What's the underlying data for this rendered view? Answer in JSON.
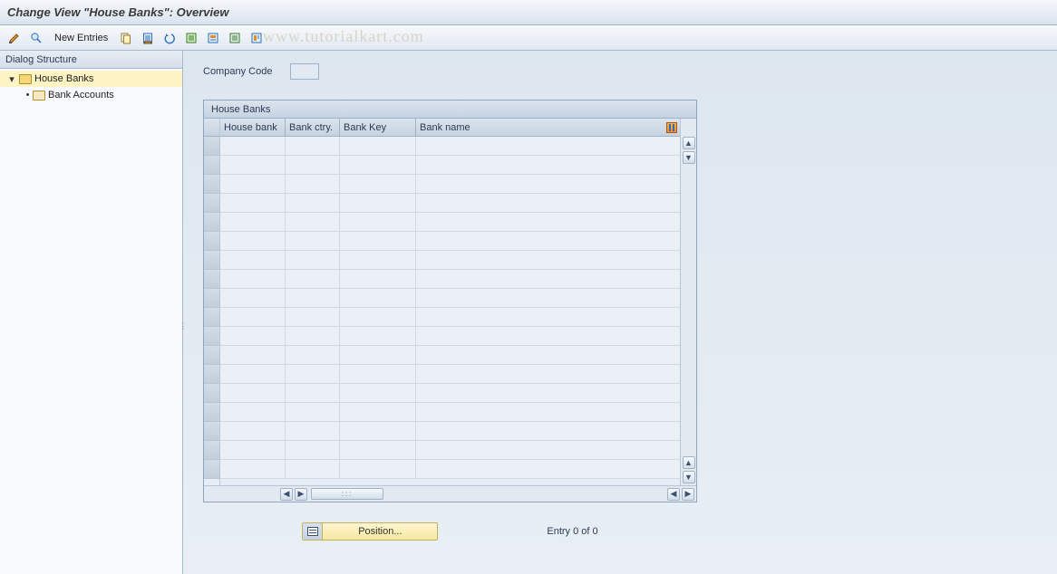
{
  "title": "Change View \"House Banks\": Overview",
  "watermark": "www.tutorialkart.com",
  "toolbar": {
    "new_entries_label": "New Entries"
  },
  "sidebar": {
    "header": "Dialog Structure",
    "items": [
      {
        "label": "House Banks",
        "selected": true,
        "expanded": true,
        "level": 1
      },
      {
        "label": "Bank Accounts",
        "selected": false,
        "expanded": false,
        "level": 2
      }
    ]
  },
  "form": {
    "company_code_label": "Company Code",
    "company_code_value": ""
  },
  "table": {
    "title": "House Banks",
    "columns": {
      "house_bank": "House bank",
      "bank_ctry": "Bank ctry.",
      "bank_key": "Bank Key",
      "bank_name": "Bank name"
    },
    "rows": []
  },
  "footer": {
    "position_label": "Position...",
    "entry_status": "Entry 0 of 0"
  }
}
